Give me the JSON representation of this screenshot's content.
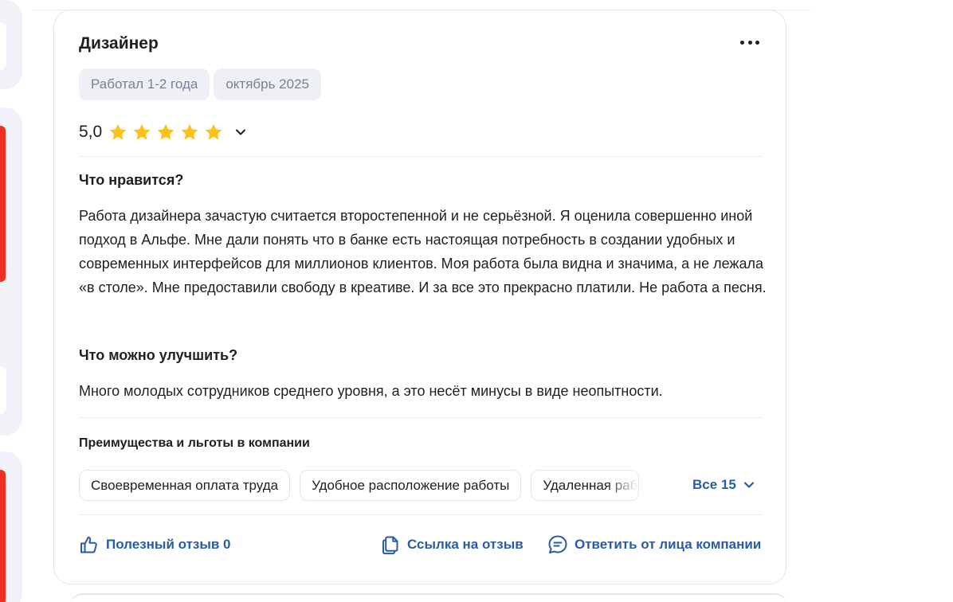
{
  "review": {
    "title": "Дизайнер",
    "tags": [
      "Работал 1-2 года",
      "октябрь 2025"
    ],
    "rating": {
      "value": "5,0",
      "stars": 5,
      "max_stars": 5,
      "star_color": "#FDC117"
    },
    "likes": {
      "title": "Что нравится?",
      "text": "Работа дизайнера зачастую считается второстепенной и не серьёзной. Я оценила совершенно иной подход в Альфе. Мне дали понять что в банке есть настоящая потребность в создании удобных и современных интерфейсов для миллионов клиентов. Моя работа была видна и значима, а не лежала «в столе». Мне предоставили свободу в креативе. И за все это прекрасно платили. Не работа а песня."
    },
    "improve": {
      "title": "Что можно улучшить?",
      "text": "Много молодых сотрудников среднего уровня, а это несёт минусы в виде неопытности."
    },
    "benefits": {
      "title": "Преимущества и льготы в компании",
      "chips": [
        "Своевременная оплата труда",
        "Удобное расположение работы",
        "Удаленная работа"
      ],
      "all_label": "Все 15"
    },
    "actions": {
      "helpful": "Полезный отзыв 0",
      "link": "Ссылка на отзыв",
      "reply": "Ответить от лица компании"
    }
  },
  "colors": {
    "accent_link": "#2A5AA8",
    "brand_red": "#EF3124",
    "tag_bg": "#EEF0F5",
    "sidebar_bg": "#F1F2F7"
  },
  "icons": [
    "more-dots-icon",
    "star-icon",
    "chevron-down-icon",
    "thumbs-up-icon",
    "copy-link-icon",
    "chat-bubble-icon"
  ]
}
